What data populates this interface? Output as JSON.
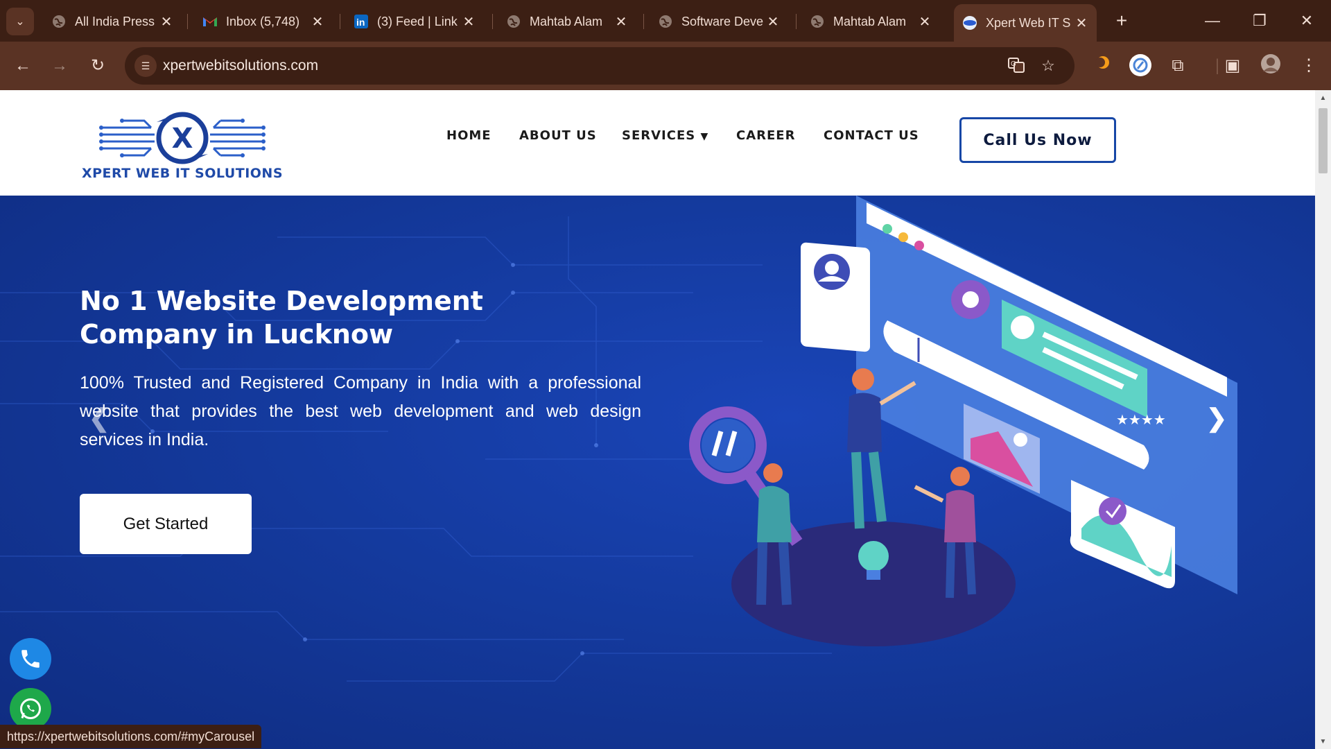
{
  "browser": {
    "tabs": [
      {
        "title": "All India Press",
        "icon": "globe-icon"
      },
      {
        "title": "Inbox (5,748)",
        "icon": "gmail-icon"
      },
      {
        "title": "(3) Feed | Link",
        "icon": "linkedin-icon"
      },
      {
        "title": "Mahtab Alam",
        "icon": "globe-icon"
      },
      {
        "title": "Software Deve",
        "icon": "globe-icon"
      },
      {
        "title": "Mahtab Alam",
        "icon": "globe-icon"
      },
      {
        "title": "Xpert Web IT S",
        "icon": "site-favicon",
        "active": true
      }
    ],
    "address": "xpertwebitsolutions.com",
    "status_url": "https://xpertwebitsolutions.com/#myCarousel"
  },
  "site": {
    "logo_text": "XPERT WEB IT SOLUTIONS",
    "logo_letter": "X",
    "nav": {
      "home": "HOME",
      "about": "ABOUT US",
      "services": "SERVICES",
      "career": "CAREER",
      "contact": "CONTACT US"
    },
    "call_button": "Call Us Now"
  },
  "hero": {
    "title": "No 1 Website Development Company in Lucknow",
    "subtitle": "100% Trusted and Registered Company in India with a professional website that provides the best web development and web design services in India.",
    "cta": "Get Started",
    "prev_icon": "chevron-left-icon",
    "next_icon": "chevron-right-icon"
  },
  "colors": {
    "chrome_dark": "#3c1f14",
    "chrome_toolbar": "#5a3324",
    "brand_blue": "#1f4aa8",
    "hero_blue": "#143a9e",
    "phone_button": "#1e88e5",
    "whatsapp_button": "#1ea84a"
  }
}
